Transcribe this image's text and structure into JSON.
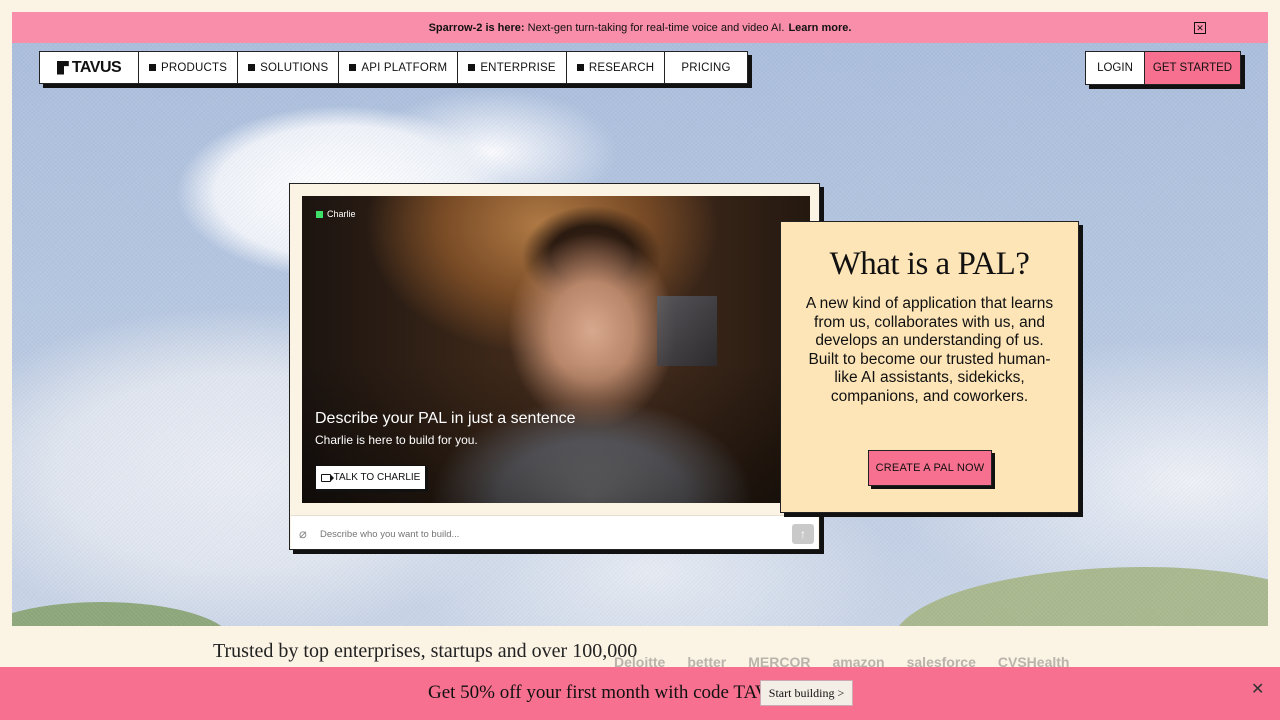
{
  "announcement": {
    "bold": "Sparrow-2 is here:",
    "text": "Next-gen turn-taking for real-time voice and video AI.",
    "link": "Learn more.",
    "close_icon": "close-icon"
  },
  "nav": {
    "logo": "TAVUS",
    "items": [
      "PRODUCTS",
      "SOLUTIONS",
      "API PLATFORM",
      "ENTERPRISE",
      "RESEARCH",
      "PRICING"
    ],
    "login": "LOGIN",
    "get_started": "GET STARTED"
  },
  "demo": {
    "live_name": "Charlie",
    "title": "Describe your PAL in just a sentence",
    "subtitle": "Charlie is here to build for you.",
    "talk_button": "TALK TO CHARLIE",
    "input_placeholder": "Describe who you want to build...",
    "send_icon": "arrow-up-icon",
    "attach_icon": "paperclip-icon"
  },
  "info": {
    "heading": "What is a PAL?",
    "body": "A new kind of application that learns from us, collaborates with us, and develops an understanding of us. Built to become our trusted human-like AI assistants, sidekicks, companions, and coworkers.",
    "cta": "CREATE A PAL NOW"
  },
  "trusted": {
    "text": "Trusted by top enterprises, startups and over 100,000",
    "logos": [
      "Deloitte",
      "better",
      "MERCOR",
      "amazon",
      "salesforce",
      "CVSHealth"
    ]
  },
  "promo": {
    "text": "Get 50% off your first month with code TAVUS50:",
    "button": "Start building >",
    "close": "✕"
  },
  "colors": {
    "pink": "#f7708f",
    "announce_pink": "#f98eaa",
    "cream": "#fde5b7"
  }
}
